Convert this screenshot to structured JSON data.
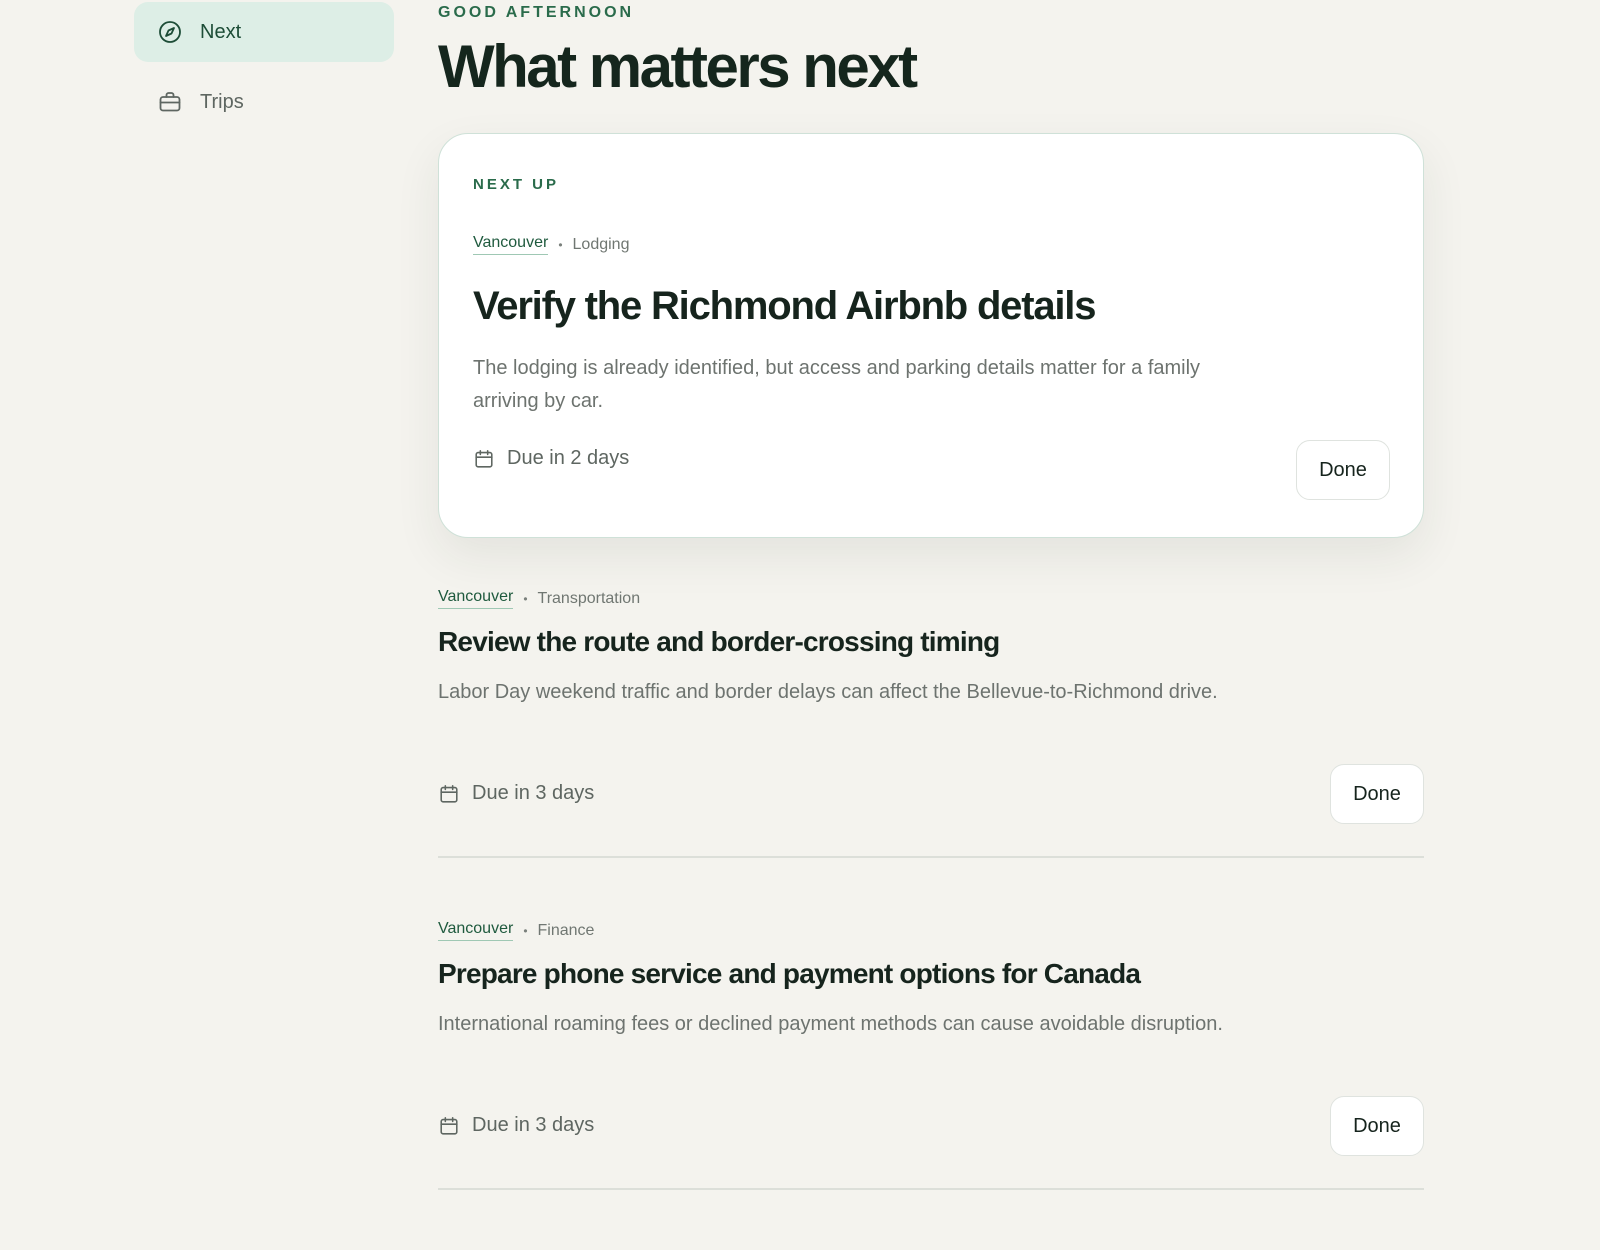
{
  "sidebar": {
    "items": [
      {
        "label": "Next",
        "icon": "compass-icon",
        "active": true
      },
      {
        "label": "Trips",
        "icon": "briefcase-icon",
        "active": false
      }
    ]
  },
  "header": {
    "greeting": "GOOD AFTERNOON",
    "title": "What matters next"
  },
  "next_up": {
    "eyebrow": "NEXT UP",
    "trip": "Vancouver",
    "category": "Lodging",
    "title": "Verify the Richmond Airbnb details",
    "description": "The lodging is already identified, but access and parking details matter for a family arriving by car.",
    "due": "Due in 2 days",
    "done_label": "Done"
  },
  "tasks": [
    {
      "trip": "Vancouver",
      "category": "Transportation",
      "title": "Review the route and border-crossing timing",
      "description": "Labor Day weekend traffic and border delays can affect the Bellevue-to-Richmond drive.",
      "due": "Due in 3 days",
      "done_label": "Done"
    },
    {
      "trip": "Vancouver",
      "category": "Finance",
      "title": "Prepare phone service and payment options for Canada",
      "description": "International roaming fees or declined payment methods can cause avoidable disruption.",
      "due": "Due in 3 days",
      "done_label": "Done"
    }
  ],
  "colors": {
    "background": "#f4f3ee",
    "accent": "#2a6b4b",
    "active_nav": "#ddeee6",
    "card": "#ffffff"
  }
}
